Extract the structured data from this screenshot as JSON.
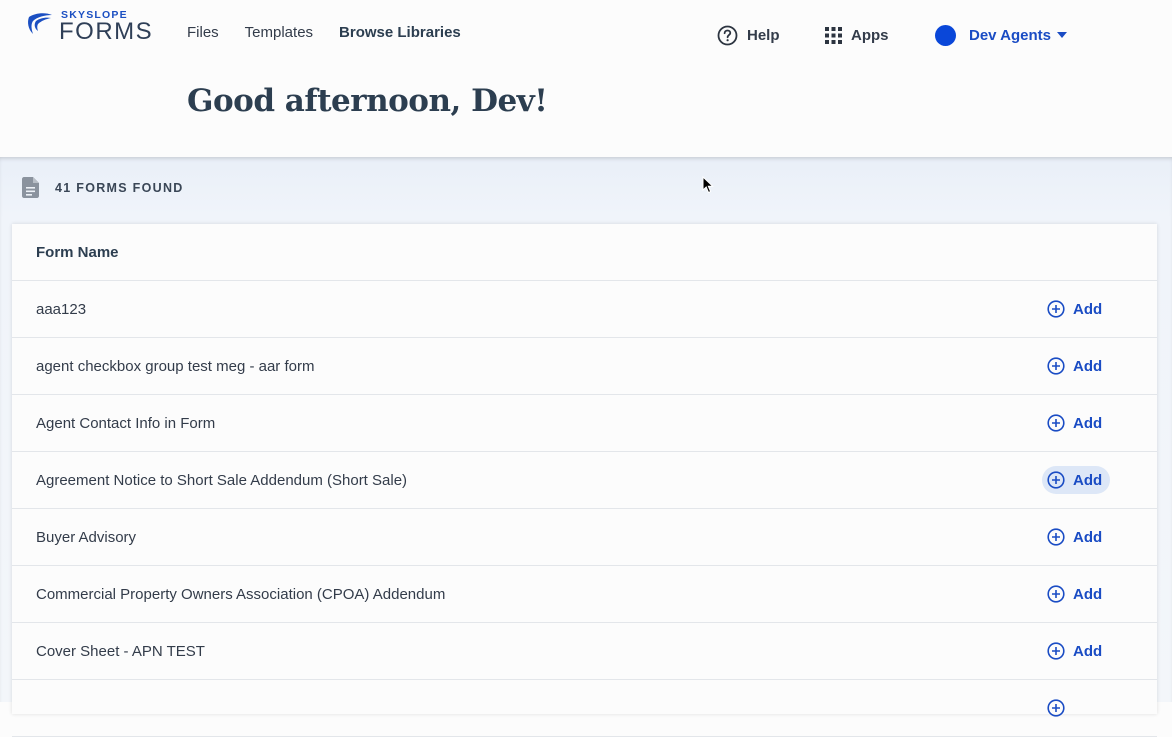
{
  "brand": {
    "top": "SKYSLOPE",
    "main": "FORMS",
    "color": "#1b4fc2"
  },
  "nav": [
    {
      "label": "Files",
      "active": false
    },
    {
      "label": "Templates",
      "active": false
    },
    {
      "label": "Browse Libraries",
      "active": true
    }
  ],
  "header_right": {
    "help": {
      "label": "Help",
      "icon": "question-circle-icon"
    },
    "apps": {
      "label": "Apps",
      "icon": "grid-icon"
    },
    "user": {
      "label": "Dev Agents",
      "icon": "chevron-down-icon",
      "avatar_color": "#0a47d9"
    }
  },
  "greeting": "Good afternoon, Dev!",
  "results": {
    "count_text": "41 FORMS FOUND",
    "icon": "document-icon"
  },
  "table": {
    "header": "Form Name",
    "add_label": "Add",
    "add_icon": "plus-circle-icon",
    "rows": [
      {
        "name": "aaa123"
      },
      {
        "name": "agent checkbox group test meg - aar form"
      },
      {
        "name": "Agent Contact Info in Form"
      },
      {
        "name": "Agreement Notice to Short Sale Addendum (Short Sale)"
      },
      {
        "name": "Buyer Advisory"
      },
      {
        "name": "Commercial Property Owners Association (CPOA) Addendum"
      },
      {
        "name": "Cover Sheet - APN TEST"
      },
      {
        "name": ""
      }
    ]
  },
  "colors": {
    "accent": "#1a4cc4",
    "text": "#2c3e50",
    "band": "#eef3fa",
    "hover": "#dde7f7"
  }
}
